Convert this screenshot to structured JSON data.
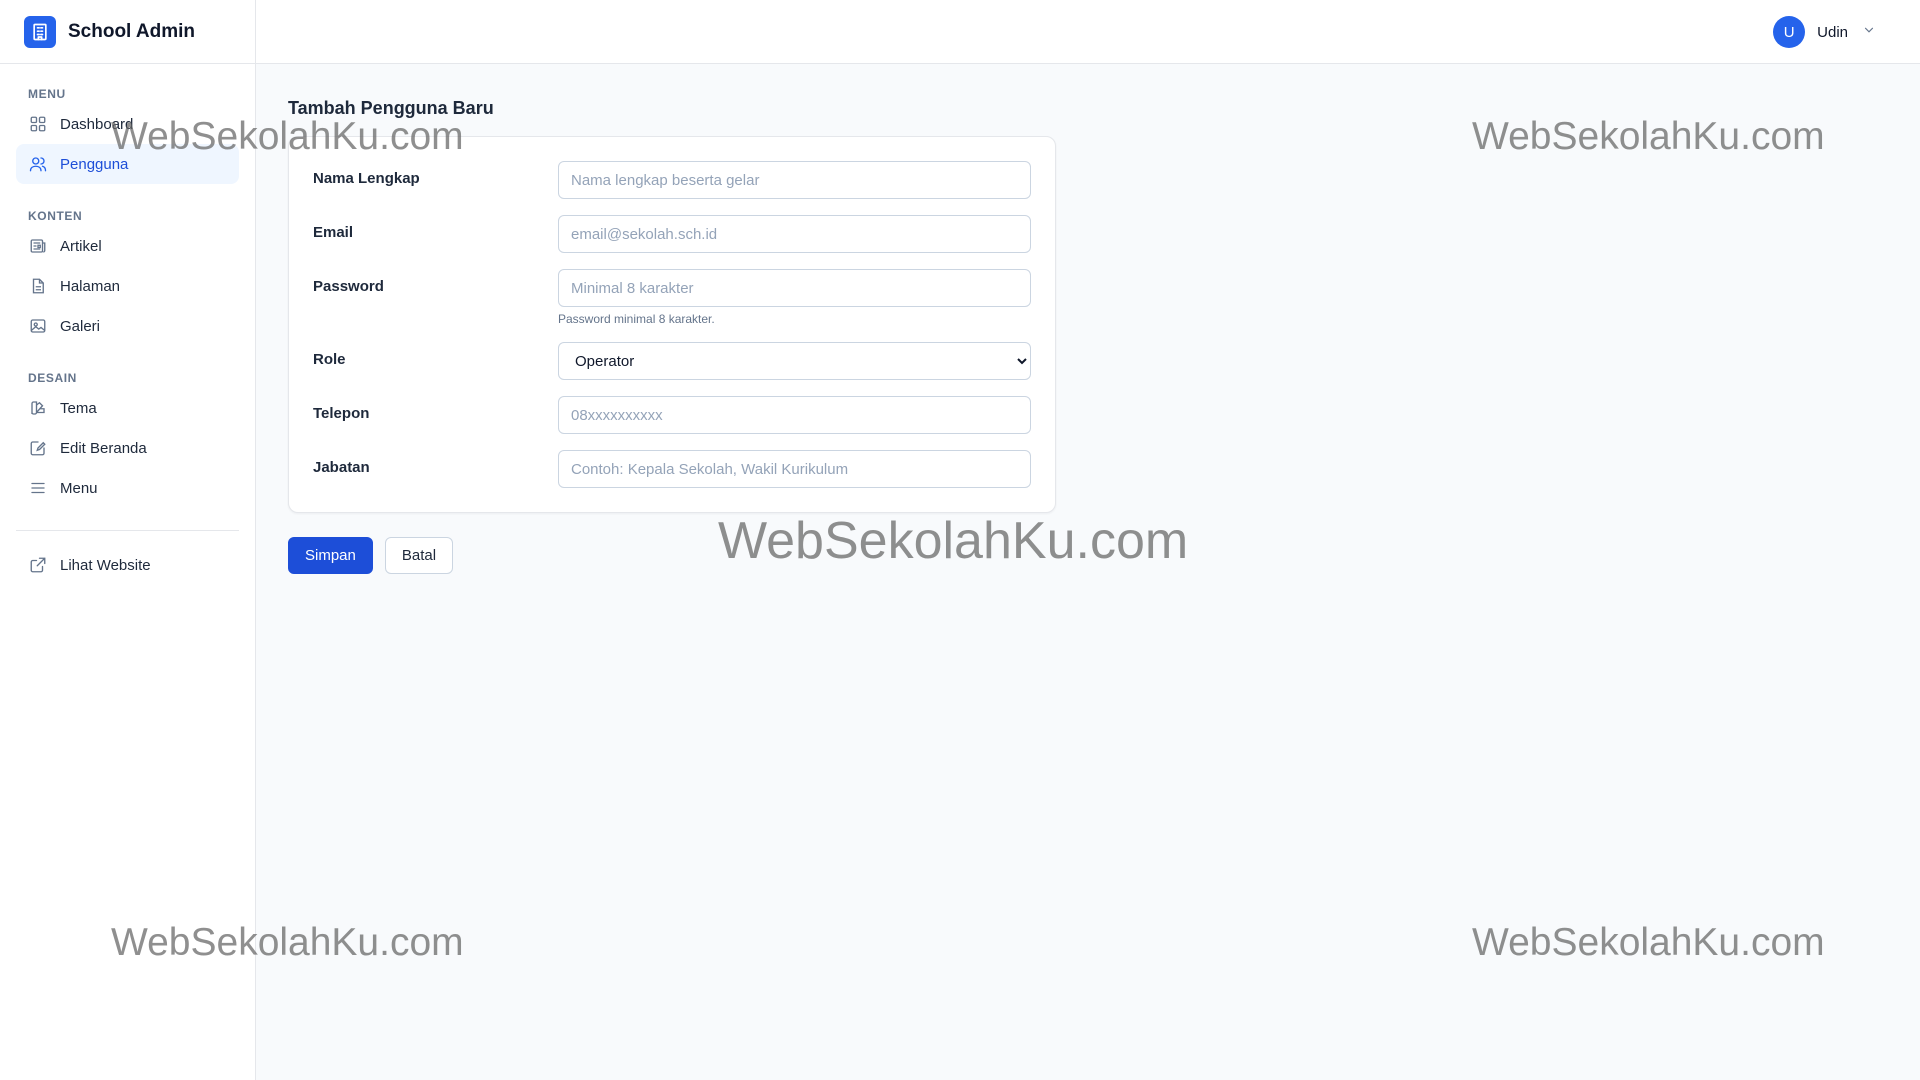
{
  "app": {
    "title": "School Admin"
  },
  "sidebar": {
    "sections": [
      {
        "label": "MENU",
        "items": [
          {
            "label": "Dashboard",
            "icon": "grid-icon",
            "active": false
          },
          {
            "label": "Pengguna",
            "icon": "users-icon",
            "active": true
          }
        ]
      },
      {
        "label": "KONTEN",
        "items": [
          {
            "label": "Artikel",
            "icon": "newspaper-icon",
            "active": false
          },
          {
            "label": "Halaman",
            "icon": "document-icon",
            "active": false
          },
          {
            "label": "Galeri",
            "icon": "image-icon",
            "active": false
          }
        ]
      },
      {
        "label": "DESAIN",
        "items": [
          {
            "label": "Tema",
            "icon": "palette-icon",
            "active": false
          },
          {
            "label": "Edit Beranda",
            "icon": "edit-icon",
            "active": false
          },
          {
            "label": "Menu",
            "icon": "menu-icon",
            "active": false
          }
        ]
      }
    ],
    "external": {
      "label": "Lihat Website",
      "icon": "external-link-icon"
    }
  },
  "header": {
    "user": {
      "initial": "U",
      "name": "Udin"
    }
  },
  "main": {
    "title": "Tambah Pengguna Baru",
    "form": {
      "nama": {
        "label": "Nama Lengkap",
        "placeholder": "Nama lengkap beserta gelar",
        "value": ""
      },
      "email": {
        "label": "Email",
        "placeholder": "email@sekolah.sch.id",
        "value": ""
      },
      "password": {
        "label": "Password",
        "placeholder": "Minimal 8 karakter",
        "value": "",
        "hint": "Password minimal 8 karakter."
      },
      "role": {
        "label": "Role",
        "selected": "Operator"
      },
      "telepon": {
        "label": "Telepon",
        "placeholder": "08xxxxxxxxxx",
        "value": ""
      },
      "jabatan": {
        "label": "Jabatan",
        "placeholder": "Contoh: Kepala Sekolah, Wakil Kurikulum",
        "value": ""
      }
    },
    "actions": {
      "save": "Simpan",
      "cancel": "Batal"
    }
  },
  "watermark": "WebSekolahKu.com",
  "colors": {
    "accent": "#2563eb",
    "active_bg": "#eff6ff",
    "background": "#f8fafc"
  }
}
